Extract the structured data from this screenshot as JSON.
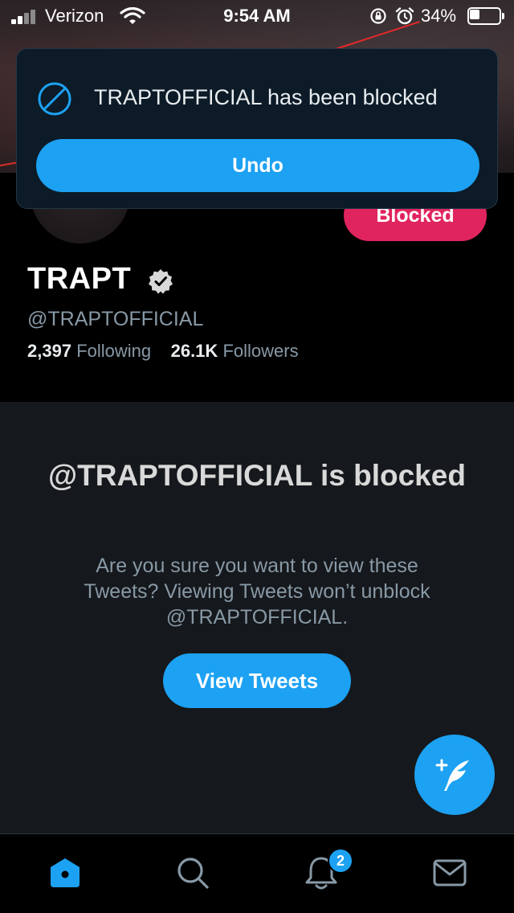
{
  "status_bar": {
    "carrier": "Verizon",
    "time": "9:54 AM",
    "battery_percent": "34%",
    "battery_level": 0.34
  },
  "toast": {
    "message": "TRAPTOFFICIAL has been blocked",
    "undo_label": "Undo",
    "icon": "block-icon"
  },
  "profile": {
    "blocked_button_label": "Blocked",
    "display_name": "TRAPT",
    "verified": true,
    "handle": "@TRAPTOFFICIAL",
    "following_count": "2,397",
    "following_label": "Following",
    "followers_count": "26.1K",
    "followers_label": "Followers"
  },
  "blocked_notice": {
    "title": "@TRAPTOFFICIAL is blocked",
    "description": "Are you sure you want to view these Tweets? Viewing Tweets won’t unblock @TRAPTOFFICIAL.",
    "view_button_label": "View Tweets"
  },
  "compose": {
    "icon": "compose-tweet-icon"
  },
  "tab_bar": {
    "tabs": [
      {
        "name": "home",
        "icon": "home-icon",
        "active": true
      },
      {
        "name": "search",
        "icon": "search-icon",
        "active": false
      },
      {
        "name": "notifications",
        "icon": "bell-icon",
        "active": false,
        "badge": "2"
      },
      {
        "name": "messages",
        "icon": "mail-icon",
        "active": false
      }
    ]
  },
  "colors": {
    "accent": "#1da1f2",
    "blocked": "#e0245e",
    "muted_text": "#8899a6",
    "section_bg": "#15181c"
  }
}
